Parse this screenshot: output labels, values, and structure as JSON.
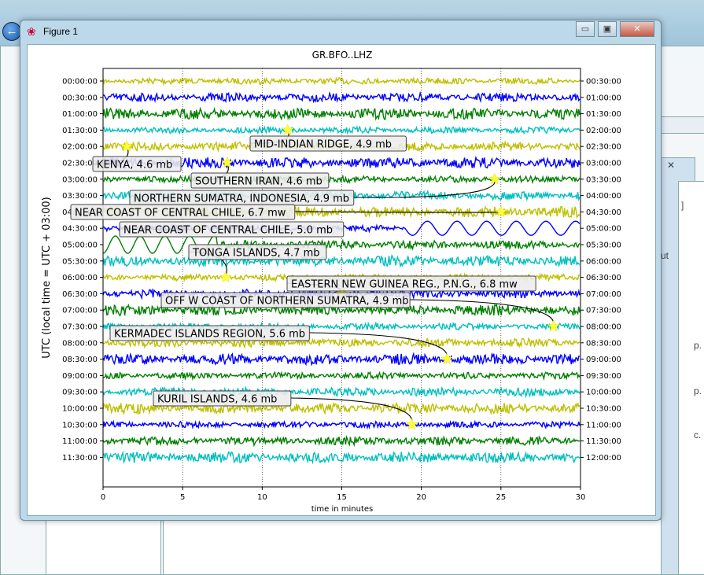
{
  "window": {
    "title": "Figure 1",
    "icon": "matplotlib-icon",
    "controls": {
      "minimize": "▭",
      "maximize": "▣",
      "close": "✕"
    }
  },
  "background": {
    "close_glyph": "✕",
    "fragments": [
      "]",
      "ut",
      "p.",
      "p.",
      "c."
    ]
  },
  "chart_data": {
    "type": "line",
    "title": "GR.BFO..LHZ",
    "xlabel": "time in minutes",
    "ylabel": "UTC (local time = UTC + 03:00)",
    "xlim": [
      0,
      30
    ],
    "xticks": [
      "0",
      "5",
      "10",
      "15",
      "20",
      "25",
      "30"
    ],
    "grid": "vertical dotted",
    "left_ticks": [
      "00:00:00",
      "00:30:00",
      "01:00:00",
      "01:30:00",
      "02:00:00",
      "02:30:00",
      "03:00:00",
      "03:30:00",
      "04:00:00",
      "04:30:00",
      "05:00:00",
      "05:30:00",
      "06:00:00",
      "06:30:00",
      "07:00:00",
      "07:30:00",
      "08:00:00",
      "08:30:00",
      "09:00:00",
      "09:30:00",
      "10:00:00",
      "10:30:00",
      "11:00:00",
      "11:30:00"
    ],
    "right_ticks": [
      "00:30:00",
      "01:00:00",
      "01:30:00",
      "02:00:00",
      "02:30:00",
      "03:00:00",
      "03:30:00",
      "04:00:00",
      "04:30:00",
      "05:00:00",
      "05:30:00",
      "06:00:00",
      "06:30:00",
      "07:00:00",
      "07:30:00",
      "08:00:00",
      "08:30:00",
      "09:00:00",
      "09:30:00",
      "10:00:00",
      "10:30:00",
      "11:00:00",
      "11:30:00",
      "12:00:00"
    ],
    "trace_colors": [
      "#bfbf00",
      "#0000ff",
      "#008000",
      "#00bfbf"
    ],
    "events": [
      {
        "label": "MID-INDIAN RIDGE, 4.9 mb",
        "row": 3,
        "minute": 11.6
      },
      {
        "label": "KENYA, 4.6 mb",
        "row": 4,
        "minute": 1.5
      },
      {
        "label": "SOUTHERN IRAN, 4.6 mb",
        "row": 5,
        "minute": 7.8
      },
      {
        "label": "NORTHERN SUMATRA, INDONESIA, 4.9 mb",
        "row": 6,
        "minute": 24.6
      },
      {
        "label": "NEAR COAST OF CENTRAL CHILE, 6.7 mw",
        "row": 8,
        "minute": 25.0
      },
      {
        "label": "NEAR COAST OF CENTRAL CHILE, 5.0 mb",
        "row": 9,
        "minute": 6.0
      },
      {
        "label": "TONGA ISLANDS, 4.7 mb",
        "row": 12,
        "minute": 7.7
      },
      {
        "label": "EASTERN NEW GUINEA REG., P.N.G., 6.8 mw",
        "row": 13,
        "minute": 15.0
      },
      {
        "label": "OFF W COAST OF NORTHERN SUMATRA, 4.9 mb",
        "row": 15,
        "minute": 28.3
      },
      {
        "label": "KERMADEC ISLANDS REGION, 5.6 mb",
        "row": 17,
        "minute": 21.6
      },
      {
        "label": "KURIL ISLANDS, 4.6 mb",
        "row": 21,
        "minute": 19.4
      }
    ]
  }
}
